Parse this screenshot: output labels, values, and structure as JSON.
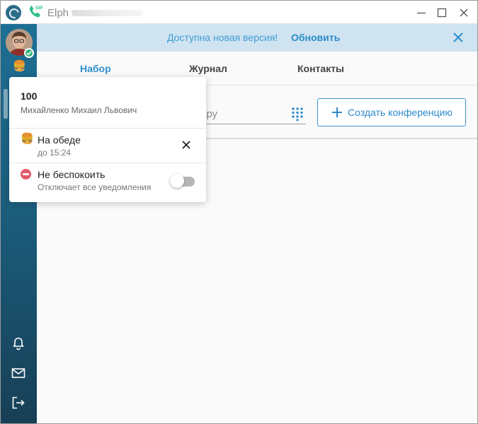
{
  "titlebar": {
    "app_name": "Elph v",
    "icons": [
      "app-logo-icon",
      "sip-phone-icon"
    ],
    "buttons": [
      "minimize-icon",
      "maximize-icon",
      "close-icon"
    ]
  },
  "banner": {
    "text": "Доступна новая версия!",
    "link": "Обновить"
  },
  "tabs": [
    {
      "label": "Набор",
      "active": true
    },
    {
      "label": "Журнал",
      "active": false
    },
    {
      "label": "Контакты",
      "active": false
    }
  ],
  "dial": {
    "text_fragment": "еру",
    "conference_button": "Создать конференцию"
  },
  "popup": {
    "number": "100",
    "name": "Михайленко Михаил Львович",
    "status": {
      "title": "На обеде",
      "until": "до 15:24",
      "emoji": "🍔"
    },
    "dnd": {
      "title": "Не беспокоить",
      "subtitle": "Отключает все уведомления",
      "enabled": false
    }
  },
  "sidebar": {
    "status_emoji": "🍔",
    "bottom_icons": [
      "bell-icon",
      "mail-icon",
      "logout-icon"
    ]
  },
  "colors": {
    "accent": "#2e8fd0",
    "sidebar_top": "#1d6f94",
    "sidebar_bottom": "#173f55",
    "banner_bg": "#cfe3f1",
    "online": "#34b37b",
    "dnd": "#e45a68"
  }
}
